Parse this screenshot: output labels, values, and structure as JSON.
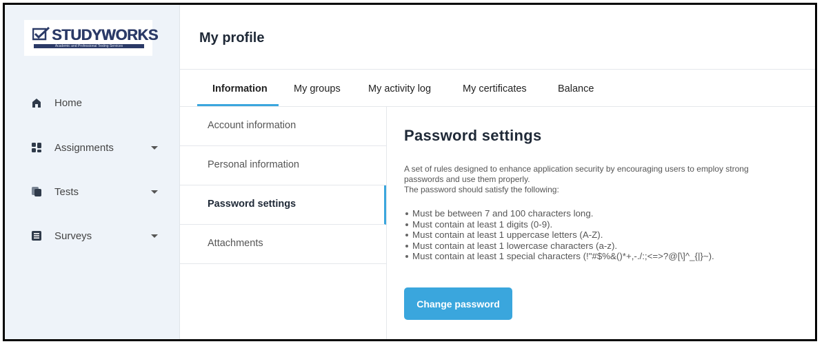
{
  "logo": {
    "name": "STUDYWORKS",
    "tagline": "Academic and Professional Testing Services"
  },
  "sidebar": {
    "items": [
      {
        "label": "Home",
        "icon": "home-icon",
        "has_dropdown": false
      },
      {
        "label": "Assignments",
        "icon": "assignments-icon",
        "has_dropdown": true
      },
      {
        "label": "Tests",
        "icon": "tests-icon",
        "has_dropdown": true
      },
      {
        "label": "Surveys",
        "icon": "surveys-icon",
        "has_dropdown": true
      }
    ]
  },
  "header": {
    "title": "My profile"
  },
  "tabs": [
    {
      "label": "Information",
      "active": true
    },
    {
      "label": "My groups",
      "active": false
    },
    {
      "label": "My activity log",
      "active": false
    },
    {
      "label": "My certificates",
      "active": false
    },
    {
      "label": "Balance",
      "active": false
    }
  ],
  "submenu": [
    {
      "label": "Account information",
      "active": false
    },
    {
      "label": "Personal information",
      "active": false
    },
    {
      "label": "Password settings",
      "active": true
    },
    {
      "label": "Attachments",
      "active": false
    }
  ],
  "content": {
    "title": "Password settings",
    "description_1": "A set of rules designed to enhance application security by encouraging users to employ strong passwords and use them properly.",
    "description_2": "The password should satisfy the following:",
    "rules": [
      "Must be between 7 and 100 characters long.",
      "Must contain at least 1 digits (0-9).",
      "Must contain at least 1 uppercase letters (A-Z).",
      "Must contain at least 1 lowercase characters (a-z).",
      "Must contain at least 1 special characters (!\"#$%&()*+,-./:;<=>?@[\\]^_{|}~)."
    ],
    "button_label": "Change password"
  },
  "colors": {
    "accent": "#3aa6dd",
    "sidebar_bg": "#eef3f9",
    "logo_navy": "#2b3a67"
  }
}
